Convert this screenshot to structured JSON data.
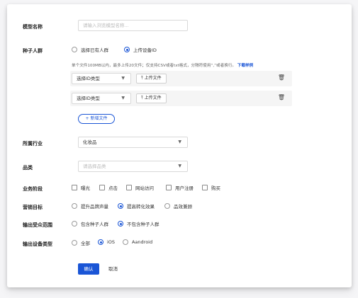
{
  "form": {
    "model_name": {
      "label": "模型名称",
      "placeholder": "请输入浏览模型名称..."
    },
    "seed_crowd": {
      "label": "种子人群",
      "options": [
        "选择已有人群",
        "上传设备ID"
      ],
      "selected": "上传设备ID",
      "hint": "单个文件100MB以内，最多上传20文件；仅支持CSV或者txt格式，分隔符使用“,”或者换行。",
      "hint_link": "下载样例",
      "files": [
        {
          "id_type": "选择ID类型",
          "upload_label": "上传文件"
        },
        {
          "id_type": "选择ID类型",
          "upload_label": "上传文件"
        }
      ],
      "add_file_label": "+ 新增文件"
    },
    "industry": {
      "label": "所属行业",
      "value": "化妆品"
    },
    "category": {
      "label": "品类",
      "placeholder": "请选择品类"
    },
    "business_stage": {
      "label": "业务阶段",
      "options": [
        "曝光",
        "点击",
        "网站访问",
        "用户注册",
        "购买"
      ]
    },
    "marketing_goal": {
      "label": "营销目标",
      "options": [
        "提升品牌声量",
        "提高转化效果",
        "品效兼顾"
      ],
      "selected": "提高转化效果"
    },
    "output_audience": {
      "label": "输出受众范围",
      "options": [
        "包含种子人群",
        "不包含种子人群"
      ],
      "selected": "不包含种子人群"
    },
    "device_type": {
      "label": "输出设备类型",
      "options": [
        "全部",
        "iOS",
        "Aandroid"
      ],
      "selected": "iOS"
    },
    "submit_label": "确认",
    "cancel_label": "取消"
  },
  "colors": {
    "primary": "#1a55d6"
  }
}
